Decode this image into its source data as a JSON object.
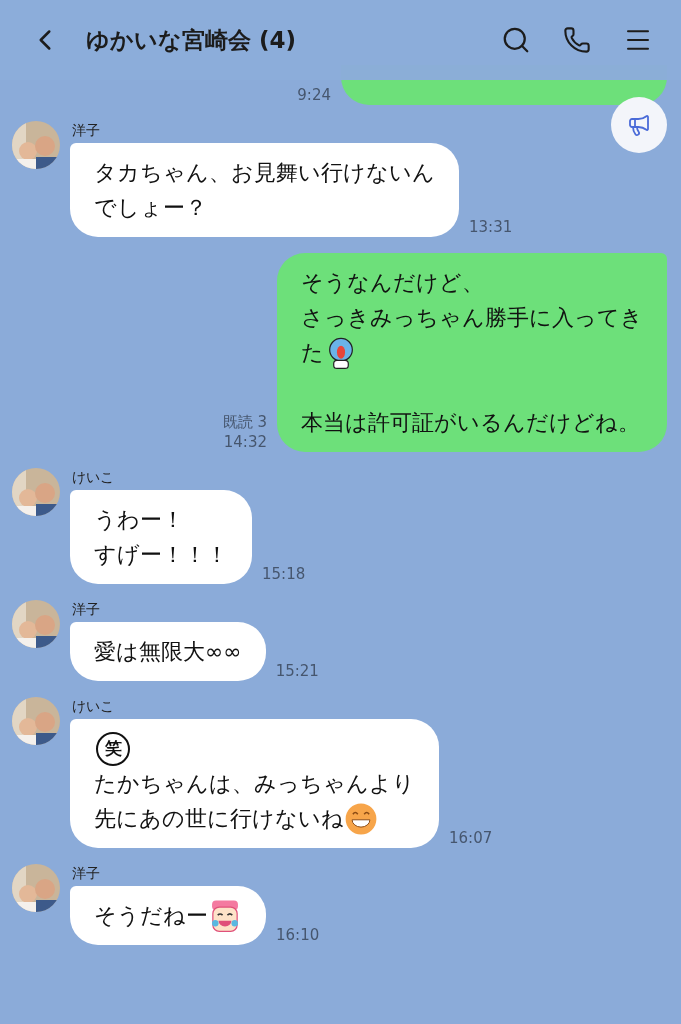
{
  "header": {
    "title": "ゆかいな宮崎会 (4)"
  },
  "messages": [
    {
      "kind": "clipped",
      "time": "9:24"
    },
    {
      "kind": "incoming",
      "sender": "洋子",
      "time": "13:31",
      "lines": [
        {
          "kind": "plain",
          "text": "タカちゃん、お見舞い行けないん"
        },
        {
          "kind": "plain",
          "text": "でしょー？"
        }
      ]
    },
    {
      "kind": "outgoing",
      "read": "既読 3",
      "time": "14:32",
      "lines": [
        {
          "kind": "plain",
          "text": "そうなんだけど、"
        },
        {
          "kind": "plain",
          "text": "さっきみっちゃん勝手に入ってき"
        },
        {
          "kind": "ghost",
          "text": "た"
        },
        {
          "kind": "blank"
        },
        {
          "kind": "plain",
          "text": "本当は許可証がいるんだけどね。"
        }
      ]
    },
    {
      "kind": "incoming",
      "sender": "けいこ",
      "time": "15:18",
      "lines": [
        {
          "kind": "plain",
          "text": "うわー！"
        },
        {
          "kind": "plain",
          "text": "すげー！！！"
        }
      ]
    },
    {
      "kind": "incoming",
      "sender": "洋子",
      "time": "15:21",
      "lines": [
        {
          "kind": "plain",
          "text": "愛は無限大∞∞"
        }
      ]
    },
    {
      "kind": "incoming",
      "sender": "けいこ",
      "time": "16:07",
      "lines": [
        {
          "kind": "stamp",
          "text": "笑"
        },
        {
          "kind": "plain",
          "text": "たかちゃんは、みっちゃんより"
        },
        {
          "kind": "smiley",
          "text": "先にあの世に行けないね"
        }
      ]
    },
    {
      "kind": "incoming",
      "sender": "洋子",
      "time": "16:10",
      "lines": [
        {
          "kind": "character",
          "text": "そうだねー"
        }
      ]
    }
  ]
}
